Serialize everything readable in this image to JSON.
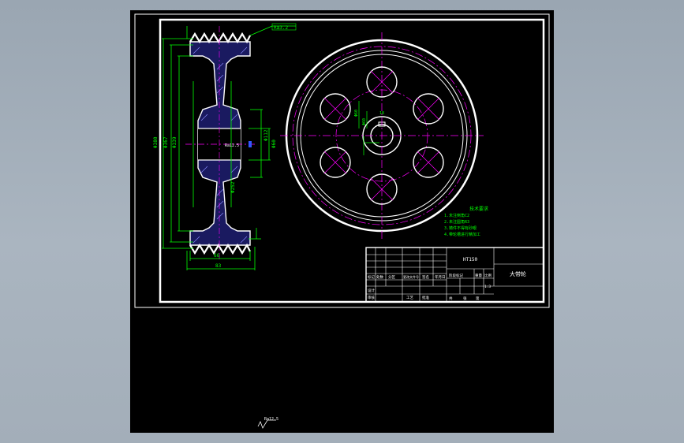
{
  "viewport": {
    "background": "#000000"
  },
  "colors": {
    "border": "#ffffff",
    "body_fill": "#1a1a60",
    "body_hatch": "#8a8aff",
    "dimension": "#00ff00",
    "center_line": "#ff00ff",
    "hole": "#ff00ff",
    "text_white": "#ffffff",
    "leader": "#00ffff"
  },
  "section_view": {
    "dim_left_outer": "Φ380",
    "dim_left_mid": "Φ367",
    "dim_left_inner": "Φ339",
    "dim_bore": "Φ60",
    "dim_hub": "Φ112",
    "dim_web": "Φ252",
    "dim_groove_width": "66",
    "dim_total_width": "83",
    "top_callout": "Ra3.2",
    "side_label": "Ra12.5",
    "bottom_roughness": "Ra12.5"
  },
  "front_view": {
    "keyway_label": "18",
    "bore_label": "Φ60",
    "hole_label": "Φ60"
  },
  "tech_requirements": {
    "title": "技术要求",
    "lines": [
      "1.未注倒角C2",
      "2.未注圆角R3",
      "3.铸件不得有砂眼",
      "4.带轮槽进行精加工"
    ]
  },
  "title_block": {
    "material": "HT150",
    "part_name": "大带轮",
    "row_labels": [
      "标记",
      "处数",
      "分区",
      "更改文件号",
      "签名",
      "年月日"
    ],
    "design": "设计",
    "check": "审核",
    "process": "工艺",
    "approve": "批准",
    "stage": "阶段标记",
    "weight": "重量",
    "scale": "比例",
    "scale_value": "1:3",
    "sheet_total": "共",
    "sheet_label": "张",
    "sheet_no": "第"
  }
}
